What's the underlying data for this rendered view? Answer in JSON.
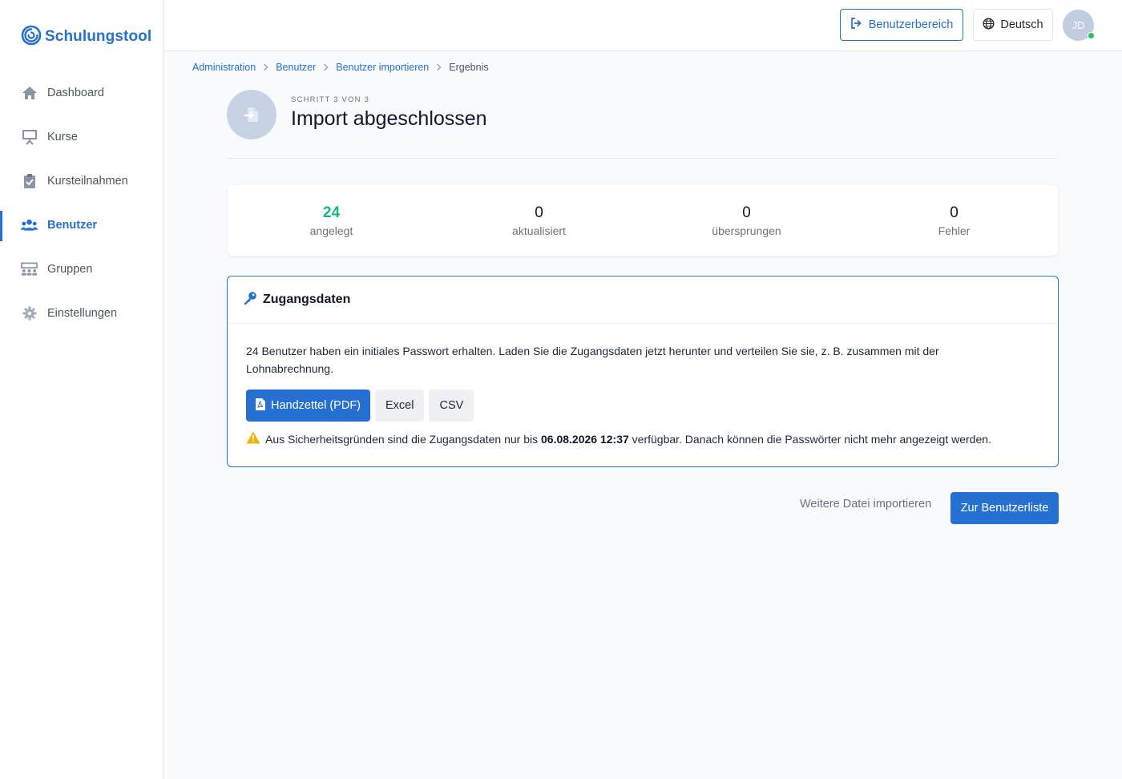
{
  "app": {
    "brand_name": "Schulungstool",
    "brand_color": "#2570d0"
  },
  "sidebar": {
    "items": [
      {
        "label": "Dashboard",
        "icon": "home-icon",
        "active": false
      },
      {
        "label": "Kurse",
        "icon": "presentation-icon",
        "active": false
      },
      {
        "label": "Kursteilnahmen",
        "icon": "clipboard-icon",
        "active": false
      },
      {
        "label": "Benutzer",
        "icon": "users-icon",
        "active": true
      },
      {
        "label": "Gruppen",
        "icon": "group-icon",
        "active": false
      },
      {
        "label": "Einstellungen",
        "icon": "gear-icon",
        "active": false
      }
    ]
  },
  "header": {
    "user_area_label": "Benutzerbereich",
    "language_label": "Deutsch",
    "avatar_initials": "JD",
    "online_status_color": "#22c55e"
  },
  "breadcrumb": {
    "items": [
      "Administration",
      "Benutzer",
      "Benutzer importieren"
    ],
    "current": "Ergebnis"
  },
  "page": {
    "step_label": "SCHRITT 3 VON 3",
    "title": "Import abgeschlossen"
  },
  "stats": [
    {
      "value": "24",
      "label": "angelegt",
      "color": "#10b981"
    },
    {
      "value": "0",
      "label": "aktualisiert"
    },
    {
      "value": "0",
      "label": "übersprungen"
    },
    {
      "value": "0",
      "label": "Fehler"
    }
  ],
  "credentials": {
    "title": "Zugangsdaten",
    "description": "24 Benutzer haben ein initiales Passwort erhalten. Laden Sie die Zugangsdaten jetzt herunter und verteilen Sie sie, z. B. zusammen mit der Lohnabrechnung.",
    "buttons": {
      "pdf": "Handzettel (PDF)",
      "excel": "Excel",
      "csv": "CSV"
    },
    "warning": {
      "prefix": "Aus Sicherheitsgründen sind die Zugangsdaten nur bis",
      "date": "06.08.2026 12:37",
      "suffix": "verfügbar. Danach können die Passwörter nicht mehr angezeigt werden.",
      "icon_color": "#f5b301"
    }
  },
  "actions": {
    "import_more": "Weitere Datei importieren",
    "to_user_list": "Zur Benutzerliste"
  }
}
